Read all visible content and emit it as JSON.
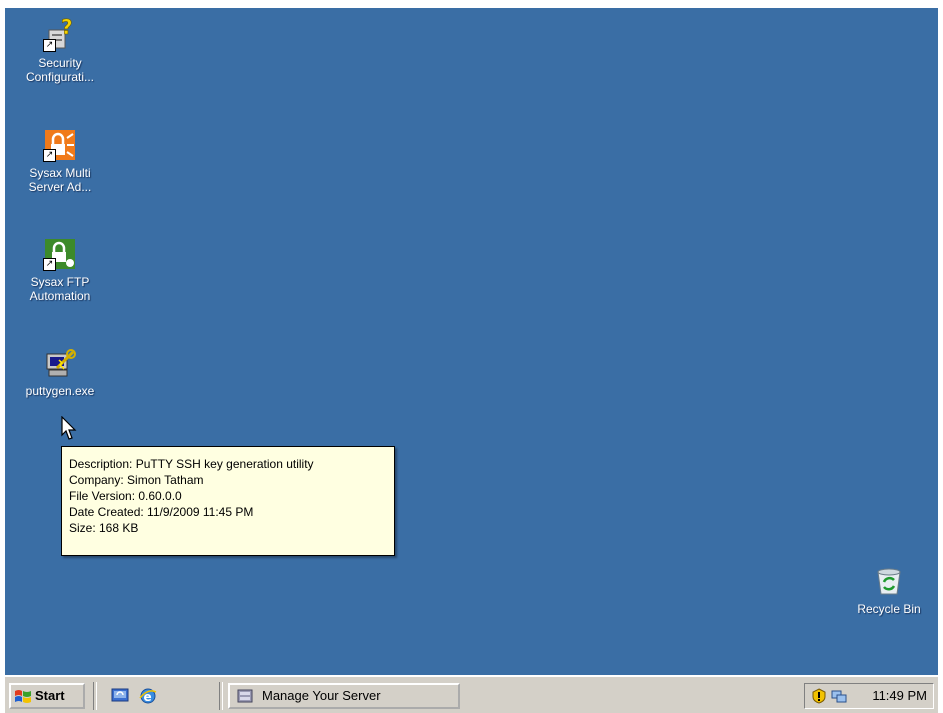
{
  "desktop": {
    "background": "#3a6ea5",
    "icons": [
      {
        "label_line1": "Security",
        "label_line2": "Configurati...",
        "icon": "security-config-icon"
      },
      {
        "label_line1": "Sysax Multi",
        "label_line2": "Server Ad...",
        "icon": "sysax-multi-server-icon"
      },
      {
        "label_line1": "Sysax FTP",
        "label_line2": "Automation",
        "icon": "sysax-ftp-icon"
      },
      {
        "label_line1": "puttygen.exe",
        "icon": "puttygen-icon"
      },
      {
        "label_line1": "Recycle Bin",
        "icon": "recycle-bin-icon"
      }
    ]
  },
  "tooltip": {
    "description": "Description: PuTTY SSH key generation utility",
    "company": "Company: Simon Tatham",
    "file_version": "File Version: 0.60.0.0",
    "date_created": "Date Created: 11/9/2009 11:45 PM",
    "size": "Size: 168 KB"
  },
  "taskbar": {
    "start_label": "Start",
    "task_label": "Manage Your Server",
    "clock": "11:49 PM"
  }
}
